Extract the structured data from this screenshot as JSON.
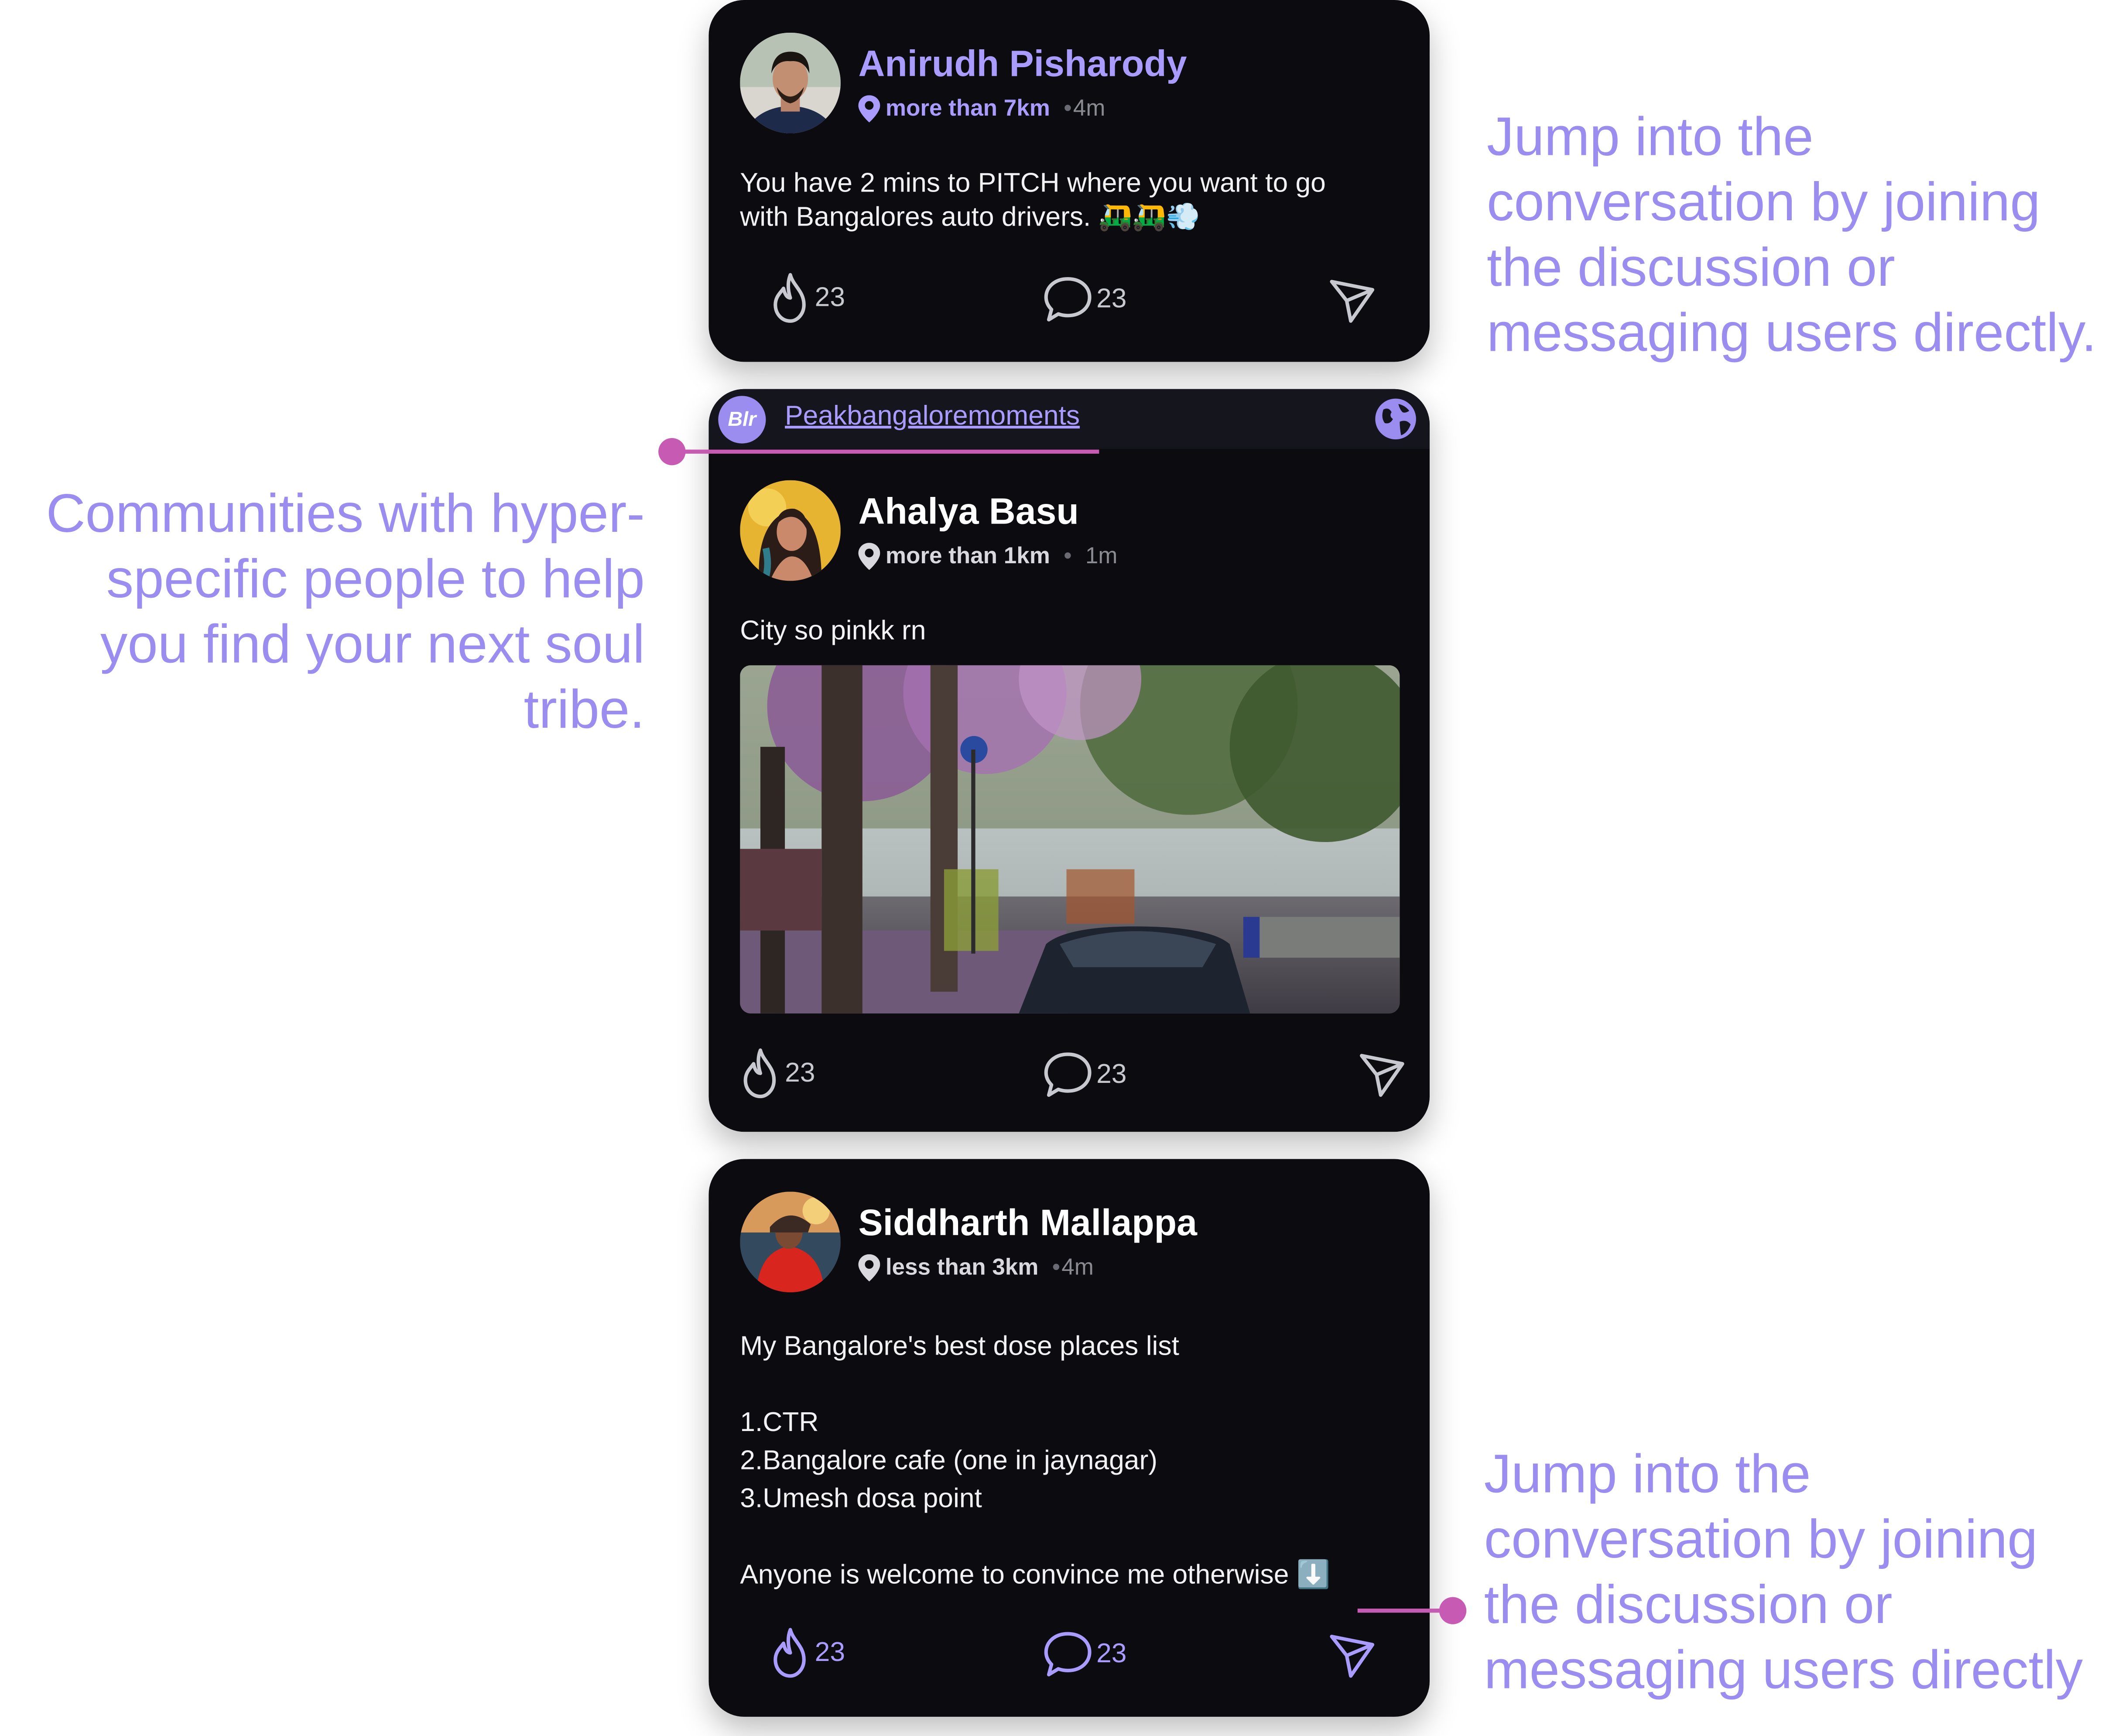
{
  "posts": [
    {
      "author": "Anirudh Pisharody",
      "distance": "more than 7km",
      "time": "4m",
      "body": "You have 2 mins to PITCH where you want to go\nwith Bangalores auto drivers. 🛺🛺💨",
      "likes": "23",
      "comments": "23"
    },
    {
      "community_badge": "Blr",
      "community_name": "Peakbangaloremoments",
      "author": "Ahalya Basu",
      "distance": "more than 1km",
      "time": "1m",
      "body": "City so pinkk rn",
      "image_desc": "street-photo",
      "likes": "23",
      "comments": "23"
    },
    {
      "author": "Siddharth Mallappa",
      "distance": "less than 3km",
      "time": "4m",
      "body": "My Bangalore's best dose places list\n\n1.CTR\n2.Bangalore cafe (one in jaynagar)\n3.Umesh dosa point\n\nAnyone is welcome to convince me otherwise ⬇️",
      "likes": "23",
      "comments": "23"
    }
  ],
  "annotations": {
    "top_right": "Jump into the\nconversation by joining\nthe discussion or\nmessaging users directly.",
    "left": "Communities with hyper-\nspecific people to help\nyou find your next soul\ntribe.",
    "bottom_right": "Jump into the\nconversation by joining\nthe discussion or\nmessaging users directly"
  },
  "colors": {
    "accent": "#9b8cf0",
    "card_bg": "#0c0c10",
    "connector": "#c75bb3"
  },
  "icons": [
    "location-pin-icon",
    "flame-icon",
    "comment-bubble-icon",
    "send-icon",
    "globe-icon"
  ]
}
